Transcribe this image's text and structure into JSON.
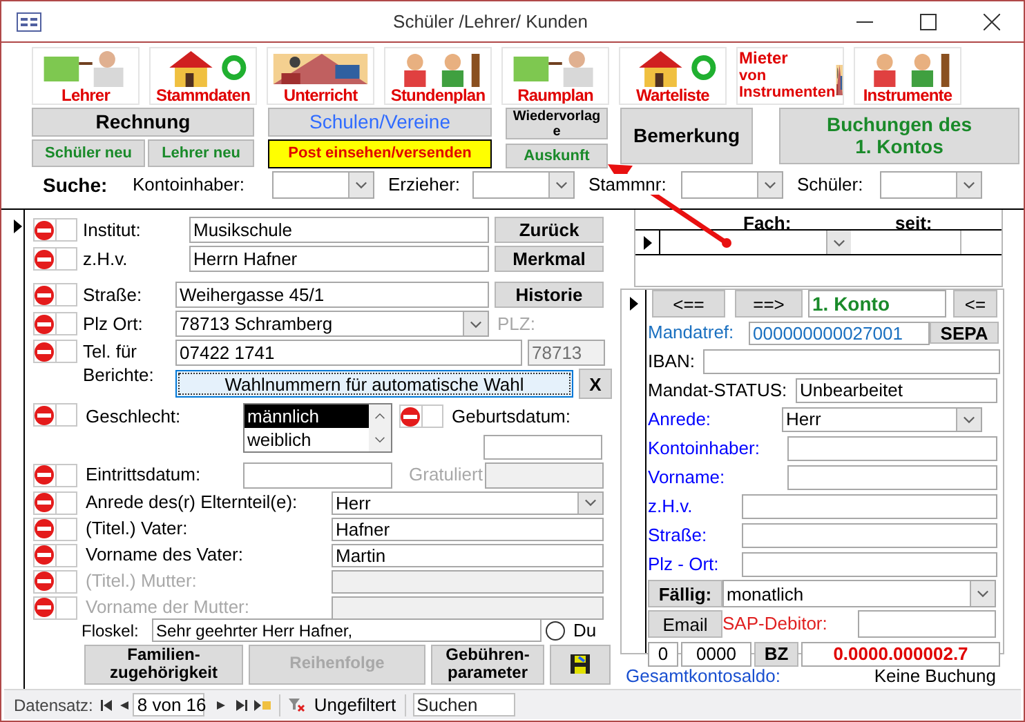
{
  "window": {
    "title": "Schüler /Lehrer/ Kunden"
  },
  "image_buttons": [
    {
      "kind": "plain",
      "lines": [
        "Lehrer"
      ]
    },
    {
      "kind": "plain",
      "lines": [
        "Stammdaten"
      ]
    },
    {
      "kind": "plain",
      "lines": [
        "Unterricht"
      ]
    },
    {
      "kind": "plain",
      "lines": [
        "Stundenplan"
      ]
    },
    {
      "kind": "plain",
      "lines": [
        "Raumplan"
      ]
    },
    {
      "kind": "plain",
      "lines": [
        "Warteliste"
      ]
    },
    {
      "kind": "stacked",
      "lines": [
        "Mieter",
        "von",
        "Instrumenten"
      ]
    },
    {
      "kind": "plain",
      "lines": [
        "Instrumente"
      ]
    }
  ],
  "buttons": [
    {
      "kind": "black",
      "lines": [
        "Rechnung"
      ]
    },
    {
      "kind": "green",
      "lines": [
        "Schüler neu"
      ]
    },
    {
      "kind": "green",
      "lines": [
        "Lehrer neu"
      ]
    },
    {
      "kind": "blue",
      "lines": [
        "Schulen/Vereine"
      ]
    },
    {
      "kind": "alert",
      "lines": [
        "Post einsehen/versenden"
      ]
    },
    {
      "kind": "black",
      "lines": [
        "Wiedervorlag",
        "e"
      ]
    },
    {
      "kind": "green",
      "lines": [
        "Auskunft"
      ]
    },
    {
      "kind": "black",
      "lines": [
        "Bemerkung"
      ]
    },
    {
      "kind": "green",
      "lines": [
        "Buchungen des",
        "1. Kontos"
      ]
    }
  ],
  "search": {
    "label": "Suche:",
    "filters": [
      {
        "label": "Kontoinhaber:"
      },
      {
        "label": "Erzieher:"
      },
      {
        "label": "Stammnr:"
      },
      {
        "label": "Schüler:"
      }
    ]
  },
  "fields": [
    {
      "label": "Institut:",
      "value": "Musikschule",
      "checked": false
    },
    {
      "label": "z.H.v.",
      "value": "Herrn Hafner",
      "checked": false
    },
    {
      "label": "Straße:",
      "value": "Weihergasse 45/1",
      "checked": false
    },
    {
      "label": "Plz Ort:",
      "value": "78713 Schramberg",
      "checked": false
    },
    {
      "label": "Tel. für Berichte:",
      "value": "07422 1741",
      "checked": false
    }
  ],
  "side_buttons": [
    "Zurück",
    "Merkmal",
    "Historie"
  ],
  "plz": {
    "label": "PLZ:",
    "value": "78713"
  },
  "dial_button": "Wahlnummern für automatische Wahl",
  "clear_button": "X",
  "gender": {
    "label": "Geschlecht:",
    "checked": false,
    "options": [
      {
        "label": "männlich",
        "selected": true
      },
      {
        "label": "weiblich",
        "selected": false
      }
    ]
  },
  "birthdate": {
    "label": "Geburtsdatum:",
    "checked": false
  },
  "entry_date": {
    "label": "Eintrittsdatum:",
    "checked": false
  },
  "congratulated": {
    "label": "Gratuliert"
  },
  "parents": [
    {
      "kind": "combo",
      "label": "Anrede des(r) Elternteil(e):",
      "value": "Herr",
      "disabled": false,
      "checked": false
    },
    {
      "kind": "text",
      "label": "(Titel.) Vater:",
      "value": "Hafner",
      "disabled": false,
      "checked": false
    },
    {
      "kind": "text",
      "label": "Vorname des Vater:",
      "value": "Martin",
      "disabled": false,
      "checked": false
    },
    {
      "kind": "text",
      "label": "(Titel.) Mutter:",
      "disabled": true,
      "checked": false
    },
    {
      "kind": "text",
      "label": "Vorname der Mutter:",
      "disabled": true,
      "checked": false
    }
  ],
  "greeting": {
    "label": "Floskel:",
    "value": "Sehr geehrter Herr Hafner,",
    "option": {
      "label": "Du",
      "selected": false
    }
  },
  "bottom_buttons": [
    {
      "lines": [
        "Familien-",
        "zugehörigkeit"
      ],
      "disabled": false
    },
    {
      "lines": [
        "Reihenfolge"
      ],
      "disabled": true
    },
    {
      "lines": [
        "Gebühren-",
        "parameter"
      ],
      "disabled": false
    }
  ],
  "subjects_table": {
    "columns": [
      "Fach:",
      "seit:"
    ]
  },
  "account": {
    "prev": "<==",
    "next": "==>",
    "title": "1. Konto",
    "back": "<=",
    "mandate": {
      "label": "Mandatref:",
      "value": "000000000027001"
    },
    "sepa": "SEPA",
    "fields": [
      {
        "kind": "text",
        "label": "IBAN:",
        "color": "#000000"
      },
      {
        "kind": "text",
        "label": "Mandat-STATUS:",
        "value": "Unbearbeitet",
        "color": "#000000"
      },
      {
        "kind": "combo",
        "label": "Anrede:",
        "value": "Herr",
        "color": "#0000ff"
      },
      {
        "kind": "text",
        "label": "Kontoinhaber:",
        "color": "#0000ff"
      },
      {
        "kind": "text",
        "label": "Vorname:",
        "color": "#0000ff"
      },
      {
        "kind": "text",
        "label": "z.H.v.",
        "color": "#0000ff"
      },
      {
        "kind": "text",
        "label": "Straße:",
        "color": "#0000ff"
      },
      {
        "kind": "text",
        "label": "Plz - Ort:",
        "color": "#0000ff"
      }
    ],
    "due": {
      "button": "Fällig:",
      "value": "monatlich"
    },
    "email": "Email",
    "sap": {
      "label": "SAP-Debitor:"
    },
    "codes": [
      "0",
      "0000"
    ],
    "bz": "BZ",
    "amount": "0.0000.000002.7"
  },
  "total": {
    "label": "Gesamtkontosaldo:",
    "value": "Keine Buchung"
  },
  "status_bar": {
    "label": "Datensatz:",
    "position": "8 von 16",
    "filter": "Ungefiltert",
    "search_placeholder": "Suchen"
  }
}
